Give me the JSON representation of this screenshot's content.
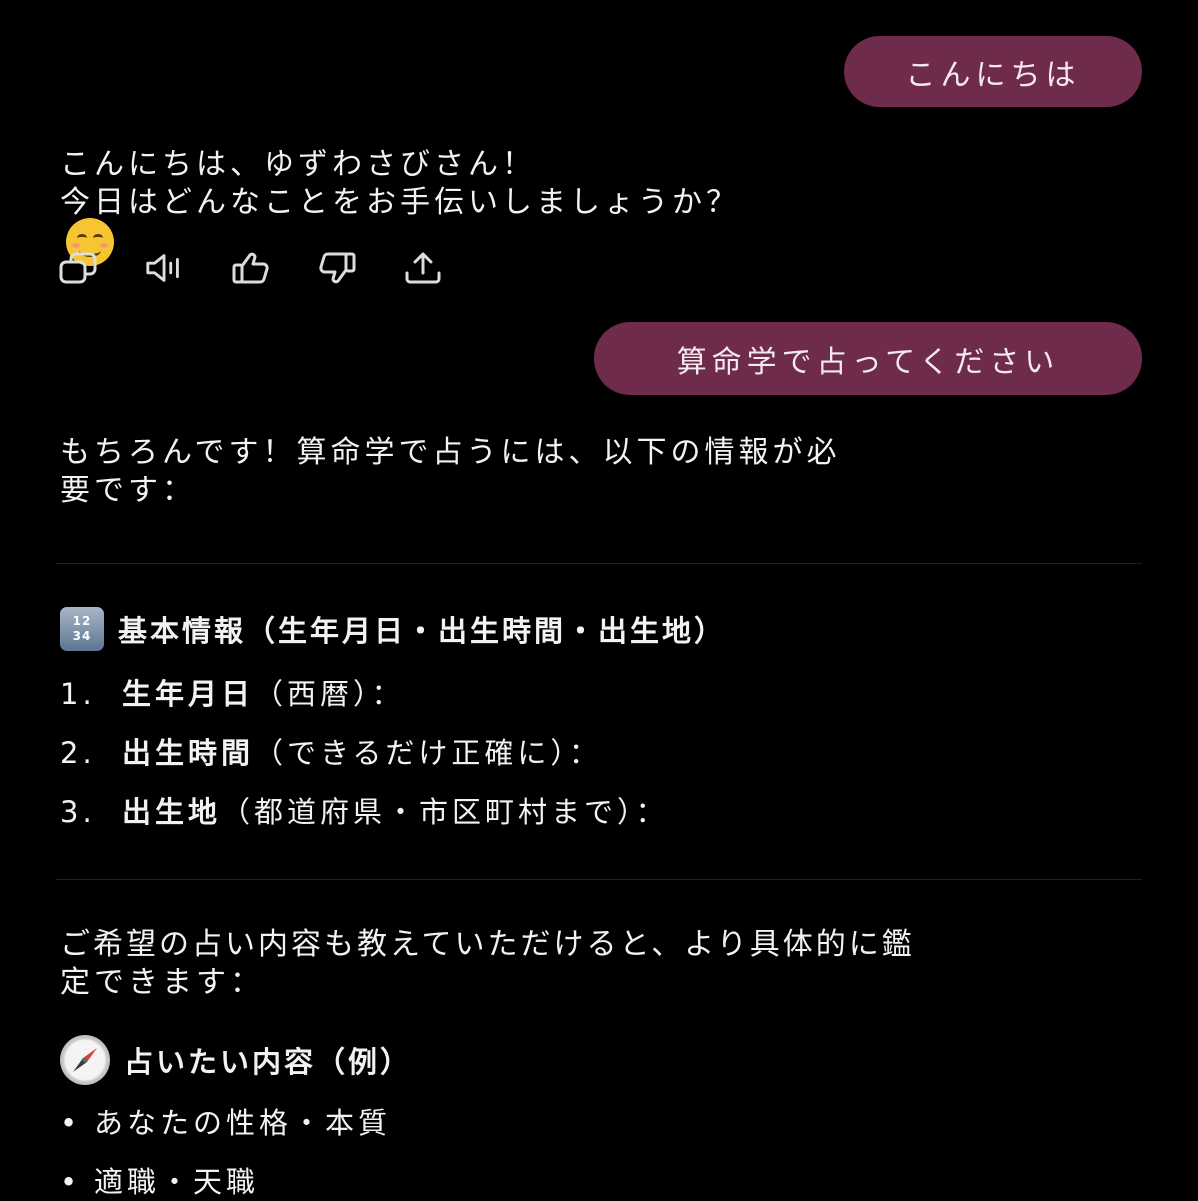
{
  "messages": {
    "user1": "こんにちは",
    "assistant1": {
      "line1": "こんにちは、ゆずわさびさん！",
      "line2": "今日はどんなことをお手伝いしましょうか？",
      "emoji": "smiling-face"
    },
    "actions": [
      {
        "name": "copy-icon"
      },
      {
        "name": "speaker-icon"
      },
      {
        "name": "thumbs-up-icon"
      },
      {
        "name": "thumbs-down-icon"
      },
      {
        "name": "share-icon"
      }
    ],
    "user2": "算命学で占ってください",
    "assistant2": {
      "intro_line1": "もちろんです！算命学で占うには、以下の情報が必",
      "intro_line2": "要です：",
      "section1_icon": "numbers-keycap-icon",
      "section1_keycap_top": "12",
      "section1_keycap_bottom": "34",
      "section1_heading": "基本情報（生年月日・出生時間・出生地）",
      "items": [
        {
          "num": "1.",
          "bold": "生年月日",
          "rest": "（西暦）："
        },
        {
          "num": "2.",
          "bold": "出生時間",
          "rest": "（できるだけ正確に）："
        },
        {
          "num": "3.",
          "bold": "出生地",
          "rest": "（都道府県・市区町村まで）："
        }
      ],
      "request_line1": "ご希望の占い内容も教えていただけると、より具体的に鑑",
      "request_line2": "定できます：",
      "section2_icon": "compass-icon",
      "section2_heading": "占いたい内容（例）",
      "bullets": [
        {
          "dot": "•",
          "text": "あなたの性格・本質"
        },
        {
          "dot": "•",
          "text": "適職・天職"
        }
      ]
    }
  },
  "colors": {
    "background": "#000000",
    "user_bubble": "#6e2b4c",
    "text": "#f2f2f2"
  }
}
